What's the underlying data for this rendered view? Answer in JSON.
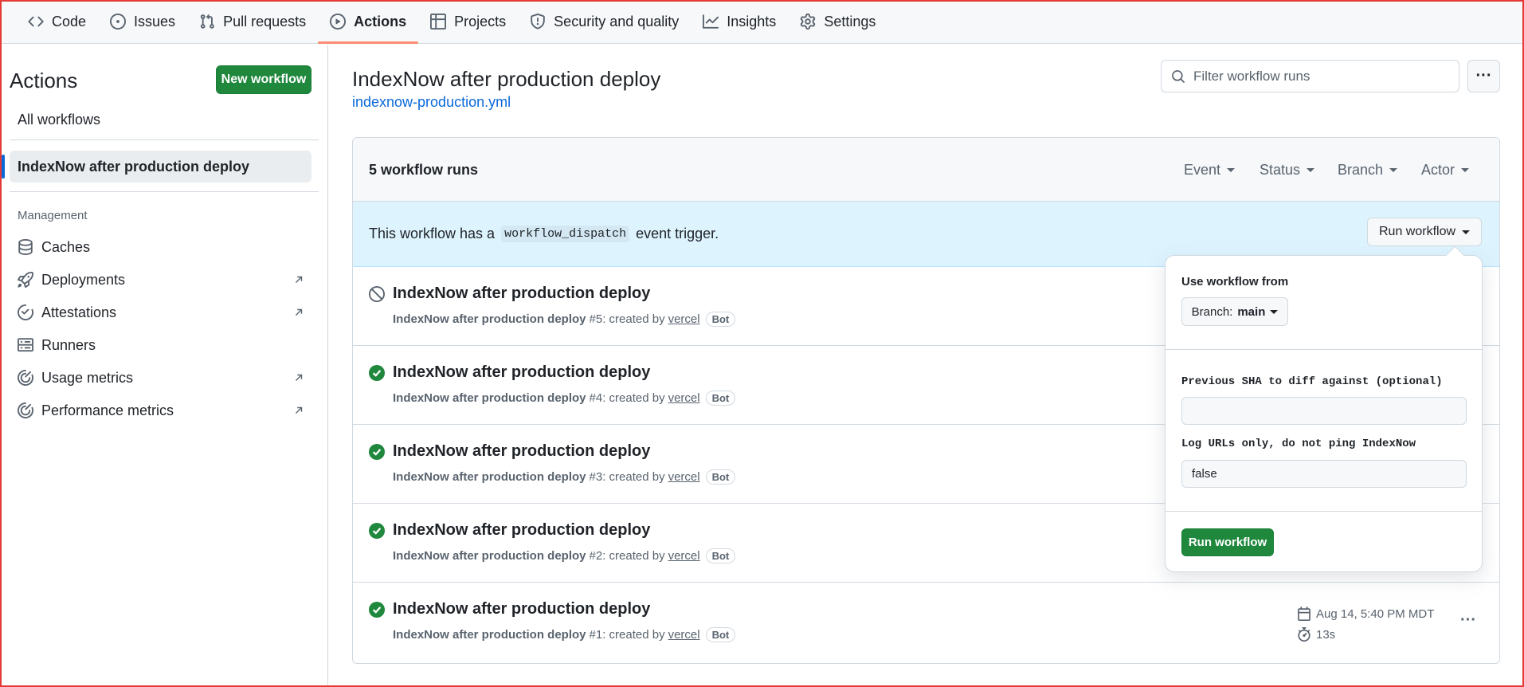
{
  "nav": {
    "tabs": [
      {
        "label": "Code",
        "icon": "code-icon"
      },
      {
        "label": "Issues",
        "icon": "issue-icon"
      },
      {
        "label": "Pull requests",
        "icon": "pull-request-icon"
      },
      {
        "label": "Actions",
        "icon": "play-icon",
        "active": true
      },
      {
        "label": "Projects",
        "icon": "table-icon"
      },
      {
        "label": "Security and quality",
        "icon": "shield-icon"
      },
      {
        "label": "Insights",
        "icon": "graph-icon"
      },
      {
        "label": "Settings",
        "icon": "gear-icon"
      }
    ]
  },
  "sidebar": {
    "title": "Actions",
    "new_workflow": "New workflow",
    "all_workflows": "All workflows",
    "selected": "IndexNow after production deploy",
    "management_heading": "Management",
    "items": [
      {
        "label": "Caches",
        "icon": "database-icon",
        "external": false
      },
      {
        "label": "Deployments",
        "icon": "rocket-icon",
        "external": true
      },
      {
        "label": "Attestations",
        "icon": "verified-icon",
        "external": true
      },
      {
        "label": "Runners",
        "icon": "server-icon",
        "external": false
      },
      {
        "label": "Usage metrics",
        "icon": "meter-icon",
        "external": true
      },
      {
        "label": "Performance metrics",
        "icon": "meter-icon",
        "external": true
      }
    ]
  },
  "main": {
    "title": "IndexNow after production deploy",
    "file": "indexnow-production.yml",
    "filter_placeholder": "Filter workflow runs",
    "more": "···",
    "runs_count": "5 workflow runs",
    "filters": [
      "Event",
      "Status",
      "Branch",
      "Actor"
    ],
    "dispatch": {
      "prefix": "This workflow has a",
      "code": "workflow_dispatch",
      "suffix": "event trigger.",
      "button": "Run workflow"
    },
    "runs": [
      {
        "title": "IndexNow after production deploy",
        "name": "IndexNow after production deploy",
        "number": "#5: created by",
        "user": "vercel",
        "bot": "Bot",
        "status": "cancelled"
      },
      {
        "title": "IndexNow after production deploy",
        "name": "IndexNow after production deploy",
        "number": "#4: created by",
        "user": "vercel",
        "bot": "Bot",
        "status": "success"
      },
      {
        "title": "IndexNow after production deploy",
        "name": "IndexNow after production deploy",
        "number": "#3: created by",
        "user": "vercel",
        "bot": "Bot",
        "status": "success"
      },
      {
        "title": "IndexNow after production deploy",
        "name": "IndexNow after production deploy",
        "number": "#2: created by",
        "user": "vercel",
        "bot": "Bot",
        "status": "success"
      },
      {
        "title": "IndexNow after production deploy",
        "name": "IndexNow after production deploy",
        "number": "#1: created by",
        "user": "vercel",
        "bot": "Bot",
        "status": "success",
        "date": "Aug 14, 5:40 PM MDT",
        "duration": "13s"
      }
    ]
  },
  "dropdown": {
    "use_from": "Use workflow from",
    "branch_prefix": "Branch:",
    "branch": "main",
    "sha_label": "Previous SHA to diff against (optional)",
    "sha_value": "",
    "log_label": "Log URLs only, do not ping IndexNow",
    "log_value": "false",
    "run_button": "Run workflow"
  },
  "colors": {
    "accent_green": "#1f883d",
    "link_blue": "#0969da",
    "tab_underline": "#fd8c73",
    "info_bg": "#ddf4ff"
  }
}
